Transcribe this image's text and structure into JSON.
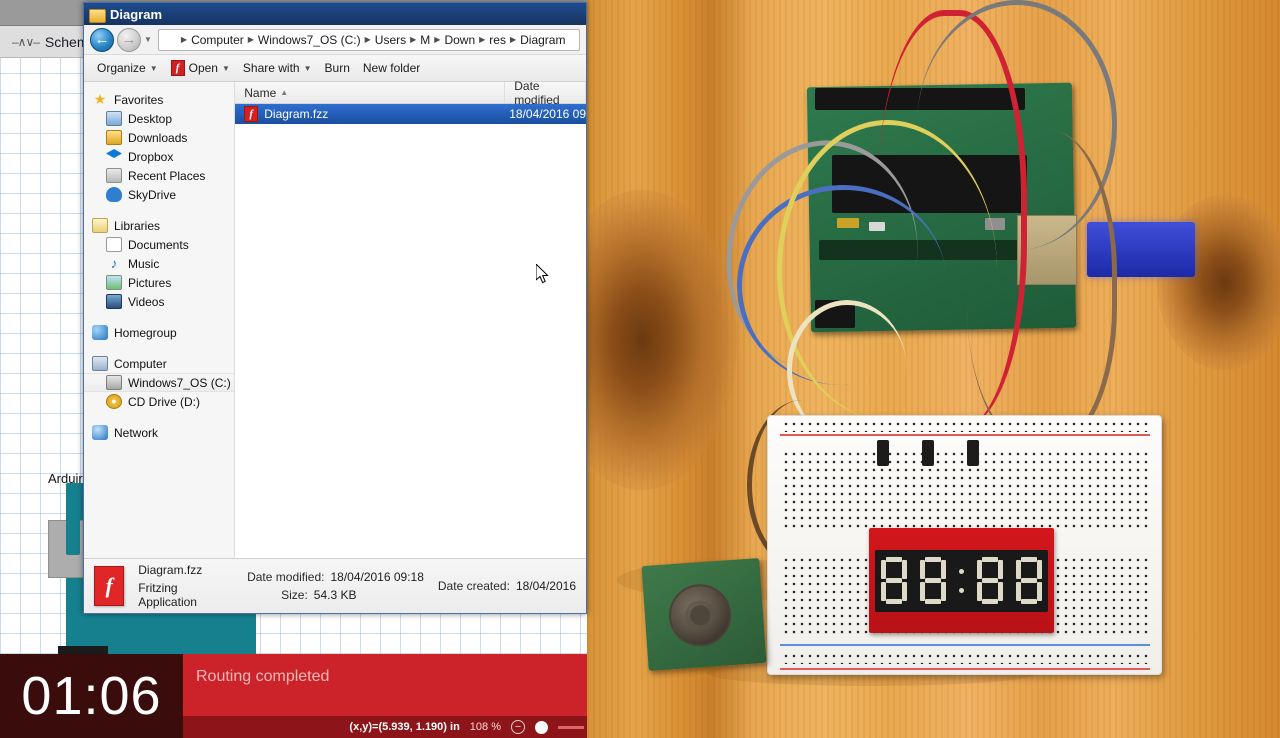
{
  "fritzing": {
    "tab_label": "Schema",
    "tab_icon": "resistor-icon",
    "part_label": "Arduir",
    "status": {
      "timer": "01:06",
      "message": "Routing completed",
      "coordinates": "(x,y)=(5.939, 1.190) in",
      "zoom": "108 %",
      "zoom_out_icon": "minus-icon"
    }
  },
  "explorer": {
    "title": "Diagram",
    "title_icon": "folder-icon",
    "nav": {
      "back_icon": "back-arrow-icon",
      "forward_icon": "forward-arrow-icon",
      "history_icon": "chevron-down-icon",
      "breadcrumb_icon": "folder-icon",
      "breadcrumb": [
        "Computer",
        "Windows7_OS (C:)",
        "Users",
        "M",
        "Down",
        "res",
        "Diagram"
      ]
    },
    "toolbar": [
      {
        "label": "Organize",
        "caret": true,
        "icon": null
      },
      {
        "label": "Open",
        "caret": true,
        "icon": "fritzing-icon"
      },
      {
        "label": "Share with",
        "caret": true,
        "icon": null
      },
      {
        "label": "Burn",
        "caret": false,
        "icon": null
      },
      {
        "label": "New folder",
        "caret": false,
        "icon": null
      }
    ],
    "sidebar": [
      {
        "label": "Favorites",
        "icon": "star-icon",
        "level": 0,
        "selected": false
      },
      {
        "label": "Desktop",
        "icon": "desktop-icon",
        "level": 1,
        "selected": false
      },
      {
        "label": "Downloads",
        "icon": "downloads-icon",
        "level": 1,
        "selected": false
      },
      {
        "label": "Dropbox",
        "icon": "dropbox-icon",
        "level": 1,
        "selected": false
      },
      {
        "label": "Recent Places",
        "icon": "recent-places-icon",
        "level": 1,
        "selected": false
      },
      {
        "label": "SkyDrive",
        "icon": "skydrive-icon",
        "level": 1,
        "selected": false
      },
      {
        "label": "Libraries",
        "icon": "libraries-icon",
        "level": 0,
        "selected": false,
        "gap_before": true
      },
      {
        "label": "Documents",
        "icon": "documents-icon",
        "level": 1,
        "selected": false
      },
      {
        "label": "Music",
        "icon": "music-icon",
        "level": 1,
        "selected": false
      },
      {
        "label": "Pictures",
        "icon": "pictures-icon",
        "level": 1,
        "selected": false
      },
      {
        "label": "Videos",
        "icon": "videos-icon",
        "level": 1,
        "selected": false
      },
      {
        "label": "Homegroup",
        "icon": "homegroup-icon",
        "level": 0,
        "selected": false,
        "gap_before": true
      },
      {
        "label": "Computer",
        "icon": "computer-icon",
        "level": 0,
        "selected": false,
        "gap_before": true
      },
      {
        "label": "Windows7_OS (C:)",
        "icon": "hard-drive-icon",
        "level": 1,
        "selected": true
      },
      {
        "label": "CD Drive (D:)",
        "icon": "cd-drive-icon",
        "level": 1,
        "selected": false
      },
      {
        "label": "Network",
        "icon": "network-icon",
        "level": 0,
        "selected": false,
        "gap_before": true
      }
    ],
    "columns": [
      {
        "label": "Name",
        "sorted": true,
        "sort_icon": "sort-ascending-icon"
      },
      {
        "label": "Date modified",
        "sorted": false,
        "sort_icon": null
      }
    ],
    "files": [
      {
        "name": "Diagram.fzz",
        "icon": "fritzing-file-icon",
        "date_modified": "18/04/2016 09",
        "selected": true
      }
    ],
    "details": {
      "icon": "fritzing-file-icon",
      "name": "Diagram.fzz",
      "type": "Fritzing Application",
      "date_modified_label": "Date modified:",
      "date_modified_value": "18/04/2016 09:18",
      "size_label": "Size:",
      "size_value": "54.3 KB",
      "date_created_label": "Date created:",
      "date_created_value": "18/04/2016"
    }
  },
  "photo": {
    "description": "arduino-breadboard-photo",
    "seven_segment_value": "8888"
  },
  "colors": {
    "accent_red": "#cc2229",
    "timer_bg": "#3a0c0c",
    "selection_blue": "#2f6fd0",
    "title_blue": "#1c4d8f",
    "pcb_green": "#2f7a4e",
    "wood": "#e8a851"
  }
}
